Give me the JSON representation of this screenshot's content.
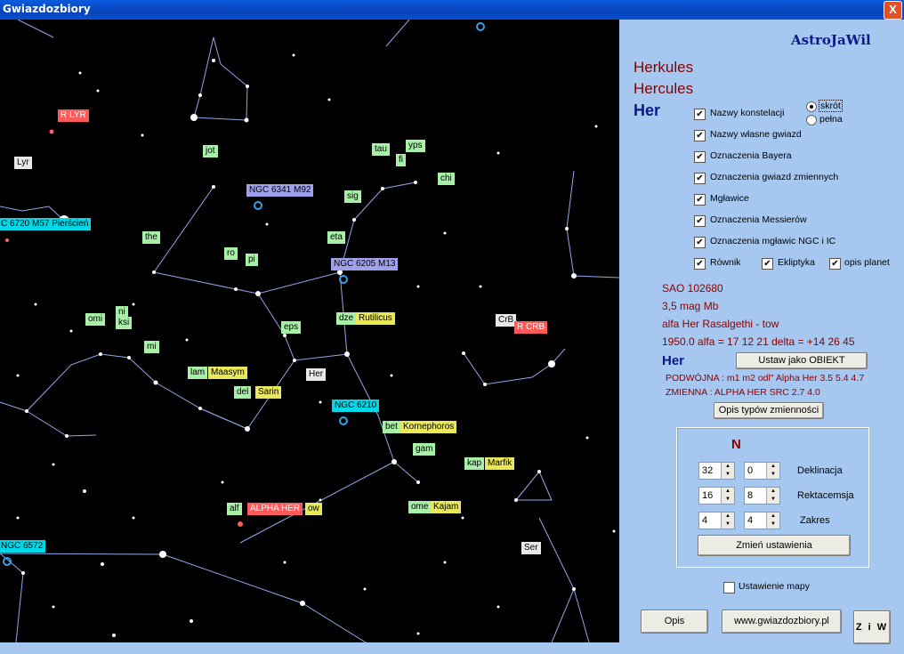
{
  "window": {
    "title": "Gwiazdozbiory",
    "close": "X"
  },
  "panel": {
    "brand": "AstroJaWil",
    "constellation_pl": "Herkules",
    "constellation_la": "Hercules",
    "abbr": "Her",
    "radio_short": "skrót",
    "radio_full": "pełna",
    "checkboxes": [
      "Nazwy konstelacji",
      "Nazwy własne gwiazd",
      "Oznaczenia Bayera",
      "Oznaczenia gwiazd zmiennych",
      "Mgławice",
      "Oznaczenia Messierów",
      "Oznaczenia mgławic NGC i IC",
      "Równik",
      "Ekliptyka",
      "opis planet"
    ],
    "star": {
      "sao": "SAO 102680",
      "mag": "3,5 mag  Mb",
      "name": "alfa Her   Rasalgethi - tow",
      "coords": "1950.0  alfa = 17 12 21    delta = +14 26 45"
    },
    "object_abbr": "Her",
    "set_object_btn": "Ustaw jako OBIEKT",
    "double": "PODWÓJNA : m1 m2 odl\"  Alpha Her  3.5 5.4 4.7",
    "variable": "ZMIENNA :  ALPHA HER   SRC     2.7  4.0",
    "var_types_btn": "Opis typów zmienności",
    "direction": "N",
    "fields": [
      {
        "v1": "32",
        "v2": "0",
        "label": "Deklinacja"
      },
      {
        "v1": "16",
        "v2": "8",
        "label": "Rektacemsja"
      },
      {
        "v1": "4",
        "v2": "4",
        "label": "Zakres"
      }
    ],
    "change_btn": "Zmień ustawienia",
    "map_setting": "Ustawienie mapy",
    "opis_btn": "Opis",
    "web_btn": "www.gwiazdozbiory.pl",
    "ziw_btn": "Z i W"
  },
  "sky_labels": [
    {
      "t": "R LYR",
      "c": "r"
    },
    {
      "t": "Lyr",
      "c": "w"
    },
    {
      "t": "C  6720 M57 Pierścień",
      "c": "c"
    },
    {
      "t": "jot",
      "c": "g"
    },
    {
      "t": "tau",
      "c": "g"
    },
    {
      "t": "yps",
      "c": "g"
    },
    {
      "t": "fi",
      "c": "g"
    },
    {
      "t": "chi",
      "c": "g"
    },
    {
      "t": "sig",
      "c": "g"
    },
    {
      "t": "NGC  6341 M92",
      "c": "v"
    },
    {
      "t": "the",
      "c": "g"
    },
    {
      "t": "eta",
      "c": "g"
    },
    {
      "t": "ro",
      "c": "g"
    },
    {
      "t": "pi",
      "c": "g"
    },
    {
      "t": "NGC  6205 M13",
      "c": "v"
    },
    {
      "t": "omi",
      "c": "g"
    },
    {
      "t": "ni",
      "c": "g"
    },
    {
      "t": "ksi",
      "c": "g"
    },
    {
      "t": "dze",
      "c": "g"
    },
    {
      "t": "Rutilicus",
      "c": "y"
    },
    {
      "t": "eps",
      "c": "g"
    },
    {
      "t": "CrB",
      "c": "w"
    },
    {
      "t": "R CRB",
      "c": "r"
    },
    {
      "t": "mi",
      "c": "g"
    },
    {
      "t": "lam",
      "c": "g"
    },
    {
      "t": "Maasym",
      "c": "y"
    },
    {
      "t": "Her",
      "c": "w"
    },
    {
      "t": "del",
      "c": "g"
    },
    {
      "t": "Sarin",
      "c": "y"
    },
    {
      "t": "NGC  6210",
      "c": "c"
    },
    {
      "t": "bet",
      "c": "g"
    },
    {
      "t": "Kornephoros",
      "c": "y"
    },
    {
      "t": "gam",
      "c": "g"
    },
    {
      "t": "kap",
      "c": "g"
    },
    {
      "t": "Marfik",
      "c": "y"
    },
    {
      "t": "ome",
      "c": "g"
    },
    {
      "t": "Kajam",
      "c": "y"
    },
    {
      "t": "alf",
      "c": "g"
    },
    {
      "t": "ALPHA HER",
      "c": "r"
    },
    {
      "t": "ow",
      "c": "y"
    },
    {
      "t": "NGC  6572",
      "c": "c"
    },
    {
      "t": "Ser",
      "c": "w"
    }
  ]
}
